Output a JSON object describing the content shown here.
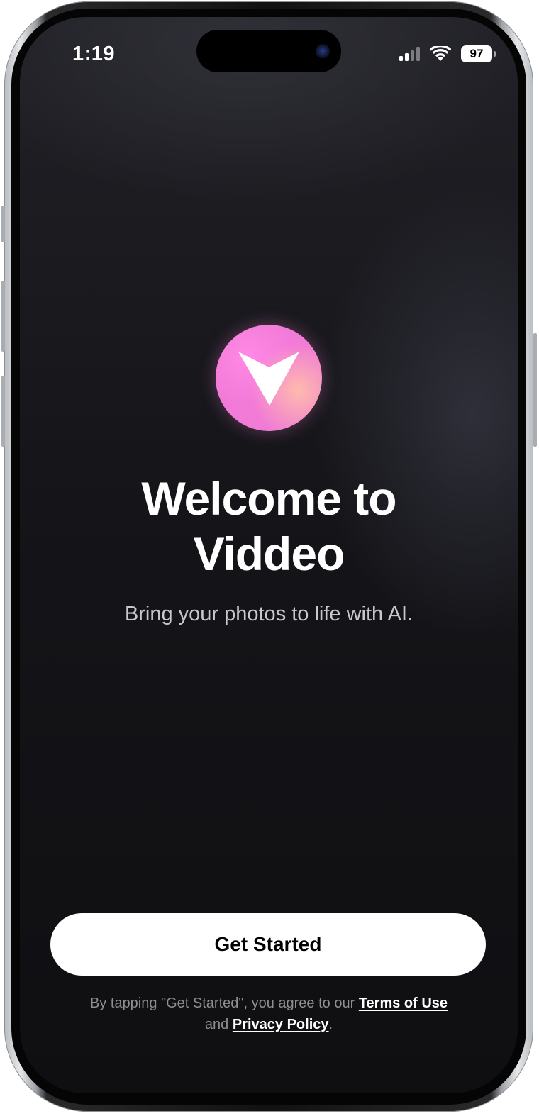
{
  "status_bar": {
    "time": "1:19",
    "battery_level": "97",
    "signal_icon": "cellular-signal-icon",
    "wifi_icon": "wifi-icon",
    "battery_icon": "battery-icon"
  },
  "app": {
    "logo_icon": "viddeo-logo-icon",
    "logo_color": "#F27AD8"
  },
  "welcome": {
    "title_line1": "Welcome to",
    "title_line2": "Viddeo",
    "subtitle": "Bring your photos to life with AI."
  },
  "actions": {
    "get_started_label": "Get Started"
  },
  "legal": {
    "prefix": "By tapping \"Get Started\", you agree to our",
    "terms_label": "Terms of Use",
    "connector": "and",
    "privacy_label": "Privacy Policy",
    "suffix": "."
  }
}
